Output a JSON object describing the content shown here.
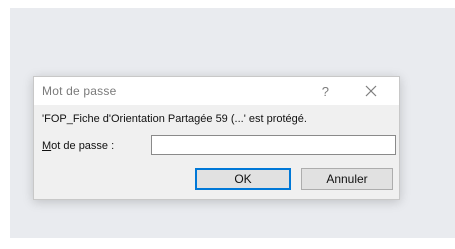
{
  "dialog": {
    "title": "Mot de passe",
    "help_label": "?",
    "close_icon": "close-icon",
    "message": "'FOP_Fiche d'Orientation Partagée 59 (...' est protégé.",
    "password_label_accel": "M",
    "password_label_rest": "ot de passe :",
    "password_value": "",
    "ok_label": "OK",
    "cancel_label": "Annuler"
  }
}
